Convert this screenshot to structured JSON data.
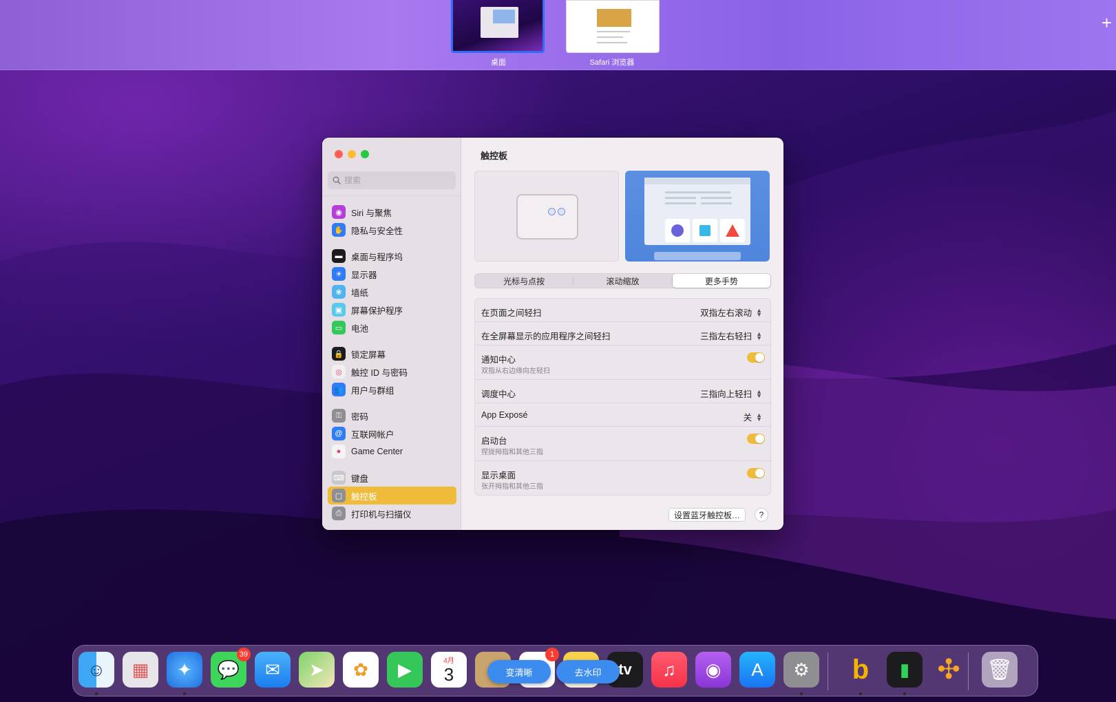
{
  "spaces": {
    "items": [
      {
        "label": "桌面"
      },
      {
        "label": "Safari 浏览器"
      }
    ],
    "add_symbol": "+"
  },
  "window": {
    "search": {
      "placeholder": "搜索"
    },
    "sidebar": {
      "items": [
        {
          "label": "Siri 与聚焦",
          "icon": "siri-icon",
          "color": "#b23fd6"
        },
        {
          "label": "隐私与安全性",
          "icon": "hand-icon",
          "color": "#2f7cf6"
        },
        {
          "label": "桌面与程序坞",
          "icon": "dock-icon",
          "color": "#1c1c1e"
        },
        {
          "label": "显示器",
          "icon": "sun-icon",
          "color": "#2f7cf6"
        },
        {
          "label": "墙纸",
          "icon": "flower-icon",
          "color": "#4fb3ee"
        },
        {
          "label": "屏幕保护程序",
          "icon": "screensaver-icon",
          "color": "#5ac8e8"
        },
        {
          "label": "电池",
          "icon": "battery-icon",
          "color": "#34c759"
        },
        {
          "label": "锁定屏幕",
          "icon": "lock-icon",
          "color": "#1c1c1e"
        },
        {
          "label": "触控 ID 与密码",
          "icon": "fingerprint-icon",
          "color": "#f0f0f0"
        },
        {
          "label": "用户与群组",
          "icon": "users-icon",
          "color": "#2f7cf6"
        },
        {
          "label": "密码",
          "icon": "key-icon",
          "color": "#8e8e93"
        },
        {
          "label": "互联网帐户",
          "icon": "at-icon",
          "color": "#2f7cf6"
        },
        {
          "label": "Game Center",
          "icon": "game-center-icon",
          "color": "#f4f4f4"
        },
        {
          "label": "键盘",
          "icon": "keyboard-icon",
          "color": "#c7c7cc"
        },
        {
          "label": "触控板",
          "icon": "trackpad-icon",
          "color": "#8e8e93"
        },
        {
          "label": "打印机与扫描仪",
          "icon": "printer-icon",
          "color": "#8e8e93"
        }
      ],
      "selected_label": "触控板",
      "accent": "#efbb3a"
    },
    "content": {
      "title": "触控板",
      "tabs": [
        {
          "label": "光标与点按"
        },
        {
          "label": "滚动缩放"
        },
        {
          "label": "更多手势"
        }
      ],
      "active_tab": "更多手势",
      "rows": [
        {
          "title": "在页面之间轻扫",
          "value": "双指左右滚动"
        },
        {
          "title": "在全屏幕显示的应用程序之间轻扫",
          "value": "三指左右轻扫"
        },
        {
          "title": "通知中心",
          "subtitle": "双指从右边缘向左轻扫",
          "toggle": true
        },
        {
          "title": "调度中心",
          "value": "三指向上轻扫"
        },
        {
          "title": "App Exposé",
          "value": "关"
        },
        {
          "title": "启动台",
          "subtitle": "捏拢拇指和其他三指",
          "toggle": true
        },
        {
          "title": "显示桌面",
          "subtitle": "张开拇指和其他三指",
          "toggle": true
        }
      ],
      "bluetooth_button": "设置蓝牙触控板…",
      "help_button": "?"
    }
  },
  "dock": {
    "apps": [
      {
        "name": "finder-icon"
      },
      {
        "name": "launchpad-icon"
      },
      {
        "name": "safari-icon"
      },
      {
        "name": "messages-icon",
        "badge": "39"
      },
      {
        "name": "mail-icon"
      },
      {
        "name": "maps-icon"
      },
      {
        "name": "photos-icon"
      },
      {
        "name": "facetime-icon"
      },
      {
        "name": "calendar-icon",
        "month": "4月",
        "day": "3"
      },
      {
        "name": "contacts-icon"
      },
      {
        "name": "reminders-icon",
        "badge": "1"
      },
      {
        "name": "notes-icon"
      },
      {
        "name": "tv-icon",
        "label": "tv"
      },
      {
        "name": "music-icon"
      },
      {
        "name": "podcasts-icon"
      },
      {
        "name": "app-store-icon"
      },
      {
        "name": "system-settings-icon"
      },
      {
        "name": "bing-icon"
      },
      {
        "name": "stocks-app-icon"
      },
      {
        "name": "propeller-app-icon"
      },
      {
        "name": "trash-icon"
      }
    ],
    "overlay_buttons": [
      {
        "label": "变清晰"
      },
      {
        "label": "去水印"
      }
    ]
  }
}
